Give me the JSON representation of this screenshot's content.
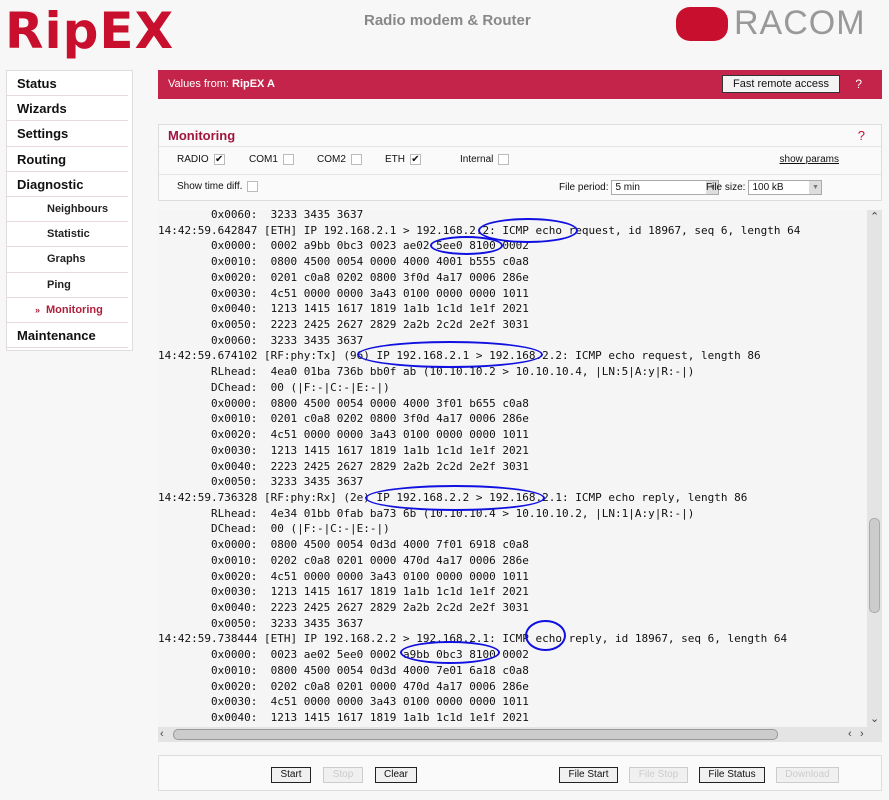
{
  "header": {
    "logo": "RipEX",
    "subtitle": "Radio modem & Router",
    "brand": "RACOM"
  },
  "sidebar": {
    "items": [
      {
        "label": "Status",
        "level": 0
      },
      {
        "label": "Wizards",
        "level": 0
      },
      {
        "label": "Settings",
        "level": 0
      },
      {
        "label": "Routing",
        "level": 0
      },
      {
        "label": "Diagnostic",
        "level": 0
      },
      {
        "label": "Neighbours",
        "level": 1
      },
      {
        "label": "Statistic",
        "level": 1
      },
      {
        "label": "Graphs",
        "level": 1
      },
      {
        "label": "Ping",
        "level": 1
      },
      {
        "label": "Monitoring",
        "level": 1,
        "active": true
      },
      {
        "label": "Maintenance",
        "level": 0
      }
    ]
  },
  "topbar": {
    "values_from_label": "Values from:",
    "unit": "RipEX A",
    "fast_remote_access": "Fast remote access",
    "help": "?"
  },
  "monitoring": {
    "title": "Monitoring",
    "help": "?",
    "interfaces": [
      {
        "label": "RADIO",
        "checked": true
      },
      {
        "label": "COM1",
        "checked": false
      },
      {
        "label": "COM2",
        "checked": false
      },
      {
        "label": "ETH",
        "checked": true
      },
      {
        "label": "Internal",
        "checked": false
      }
    ],
    "show_params": "show params",
    "show_time_diff": {
      "label": "Show time diff.",
      "checked": false
    },
    "file_period": {
      "label": "File period:",
      "value": "5 min"
    },
    "file_size": {
      "label": "File size:",
      "value": "100 kB"
    }
  },
  "log_lines": [
    "        0x0060:  3233 3435 3637",
    "14:42:59.642847 [ETH] IP 192.168.2.1 > 192.168.2.2: ICMP echo request, id 18967, seq 6, length 64",
    "        0x0000:  0002 a9bb 0bc3 0023 ae02 5ee0 8100 0002",
    "        0x0010:  0800 4500 0054 0000 4000 4001 b555 c0a8",
    "        0x0020:  0201 c0a8 0202 0800 3f0d 4a17 0006 286e",
    "        0x0030:  4c51 0000 0000 3a43 0100 0000 0000 1011",
    "        0x0040:  1213 1415 1617 1819 1a1b 1c1d 1e1f 2021",
    "        0x0050:  2223 2425 2627 2829 2a2b 2c2d 2e2f 3031",
    "        0x0060:  3233 3435 3637",
    "14:42:59.674102 [RF:phy:Tx] (96) IP 192.168.2.1 > 192.168.2.2: ICMP echo request, length 86",
    "        RLhead:  4ea0 01ba 736b bb0f ab (10.10.10.2 > 10.10.10.4, |LN:5|A:y|R:-|)",
    "        DChead:  00 (|F:-|C:-|E:-|)",
    "        0x0000:  0800 4500 0054 0000 4000 3f01 b655 c0a8",
    "        0x0010:  0201 c0a8 0202 0800 3f0d 4a17 0006 286e",
    "        0x0020:  4c51 0000 0000 3a43 0100 0000 0000 1011",
    "        0x0030:  1213 1415 1617 1819 1a1b 1c1d 1e1f 2021",
    "        0x0040:  2223 2425 2627 2829 2a2b 2c2d 2e2f 3031",
    "        0x0050:  3233 3435 3637",
    "14:42:59.736328 [RF:phy:Rx] (2e) IP 192.168.2.2 > 192.168.2.1: ICMP echo reply, length 86",
    "        RLhead:  4e34 01bb 0fab ba73 6b (10.10.10.4 > 10.10.10.2, |LN:1|A:y|R:-|)",
    "        DChead:  00 (|F:-|C:-|E:-|)",
    "        0x0000:  0800 4500 0054 0d3d 4000 7f01 6918 c0a8",
    "        0x0010:  0202 c0a8 0201 0000 470d 4a17 0006 286e",
    "        0x0020:  4c51 0000 0000 3a43 0100 0000 0000 1011",
    "        0x0030:  1213 1415 1617 1819 1a1b 1c1d 1e1f 2021",
    "        0x0040:  2223 2425 2627 2829 2a2b 2c2d 2e2f 3031",
    "        0x0050:  3233 3435 3637",
    "14:42:59.738444 [ETH] IP 192.168.2.2 > 192.168.2.1: ICMP echo reply, id 18967, seq 6, length 64",
    "        0x0000:  0023 ae02 5ee0 0002 a9bb 0bc3 8100 0002",
    "        0x0010:  0800 4500 0054 0d3d 4000 7e01 6a18 c0a8",
    "        0x0020:  0202 c0a8 0201 0000 470d 4a17 0006 286e",
    "        0x0030:  4c51 0000 0000 3a43 0100 0000 0000 1011",
    "        0x0040:  1213 1415 1617 1819 1a1b 1c1d 1e1f 2021"
  ],
  "annotation_color": "#1010e0",
  "buttons": {
    "start": "Start",
    "stop": "Stop",
    "clear": "Clear",
    "file_start": "File Start",
    "file_stop": "File Stop",
    "file_status": "File Status",
    "download": "Download"
  },
  "colors": {
    "brand_red": "#c4244a",
    "title_red": "#a0153e"
  }
}
